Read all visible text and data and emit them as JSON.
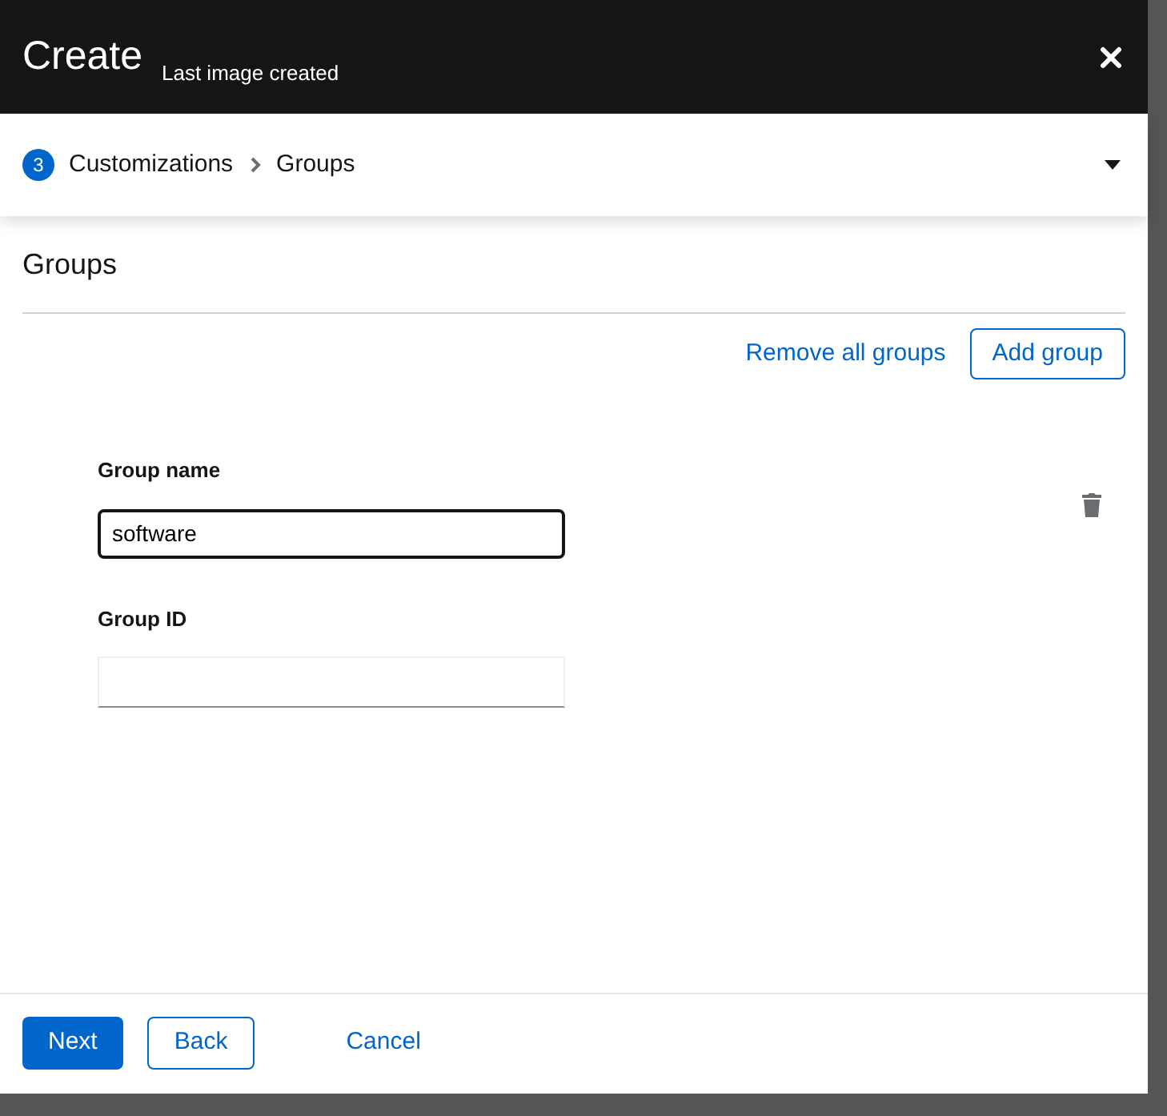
{
  "modal": {
    "title": "Create",
    "tooltip": "Last image created"
  },
  "wizard_nav": {
    "step_number": "3",
    "step": "Customizations",
    "substep": "Groups",
    "expanded": false
  },
  "section": {
    "title": "Groups"
  },
  "actions": [
    "Remove all groups",
    "Add group"
  ],
  "fields": [
    {
      "label": "Group name",
      "value": "software",
      "focused": true
    },
    {
      "label": "Group ID",
      "focused": false
    }
  ],
  "footer": {
    "buttons": [
      {
        "label": "Next",
        "kind": "primary"
      },
      {
        "label": "Back",
        "kind": "secondary"
      },
      {
        "label": "Cancel",
        "kind": "link"
      }
    ]
  }
}
